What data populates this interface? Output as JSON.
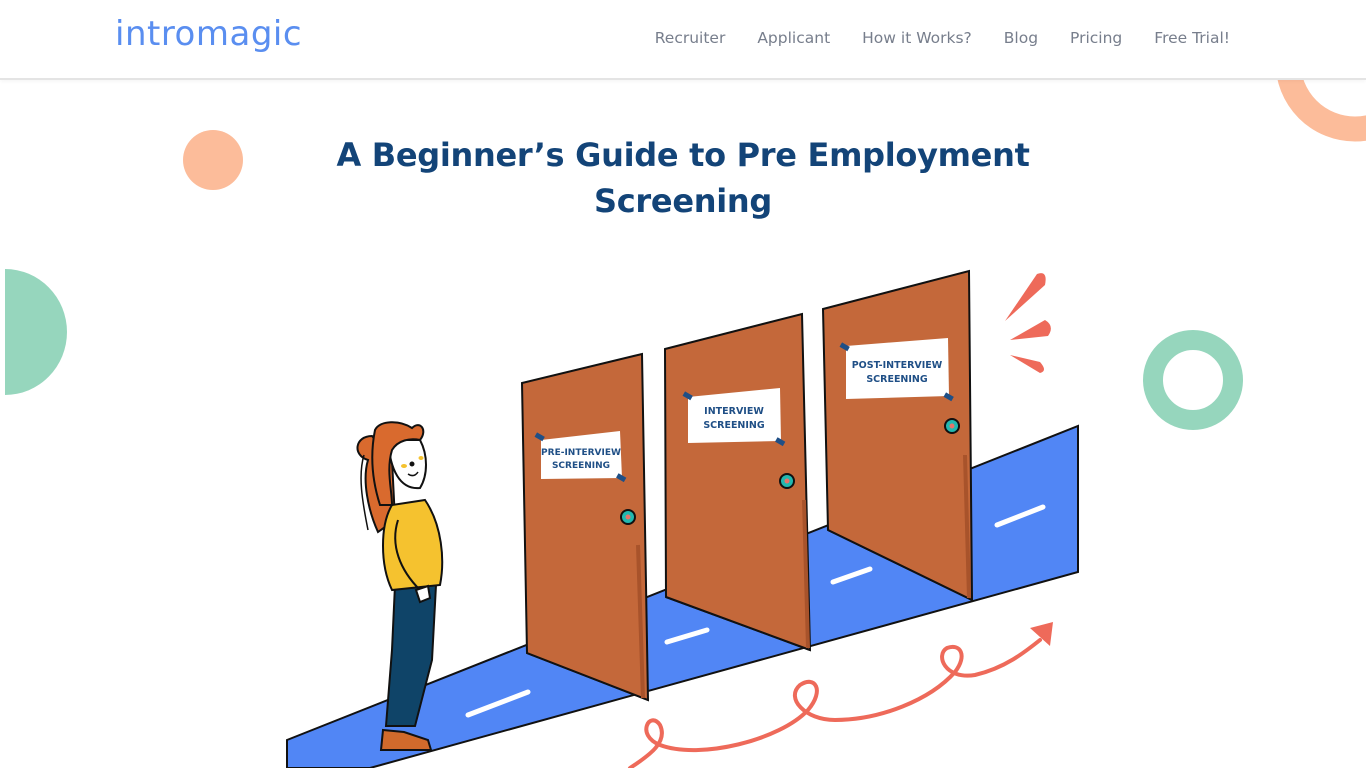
{
  "brand": {
    "logo_text": "intromagic",
    "accent_color": "#5a8ef0"
  },
  "nav": {
    "items": [
      {
        "label": "Recruiter"
      },
      {
        "label": "Applicant"
      },
      {
        "label": "How it Works?"
      },
      {
        "label": "Blog"
      },
      {
        "label": "Pricing"
      },
      {
        "label": "Free Trial!"
      }
    ]
  },
  "article": {
    "title": "A Beginner’s Guide to Pre Employment Screening",
    "title_color": "#134478"
  },
  "illustration": {
    "description": "Woman looking at three doors leading to screening stages",
    "doors": [
      {
        "sign_line1": "PRE-INTERVIEW",
        "sign_line2": "SCREENING"
      },
      {
        "sign_line1": "INTERVIEW",
        "sign_line2": "SCREENING"
      },
      {
        "sign_line1": "POST-INTERVIEW",
        "sign_line2": "SCREENING"
      }
    ],
    "colors": {
      "door": "#c4683a",
      "floor": "#5186f5",
      "arrow": "#ee6a5a",
      "sign_text": "#1f4f86",
      "peach": "#fcbc9a",
      "mint": "#96d6bd"
    }
  }
}
